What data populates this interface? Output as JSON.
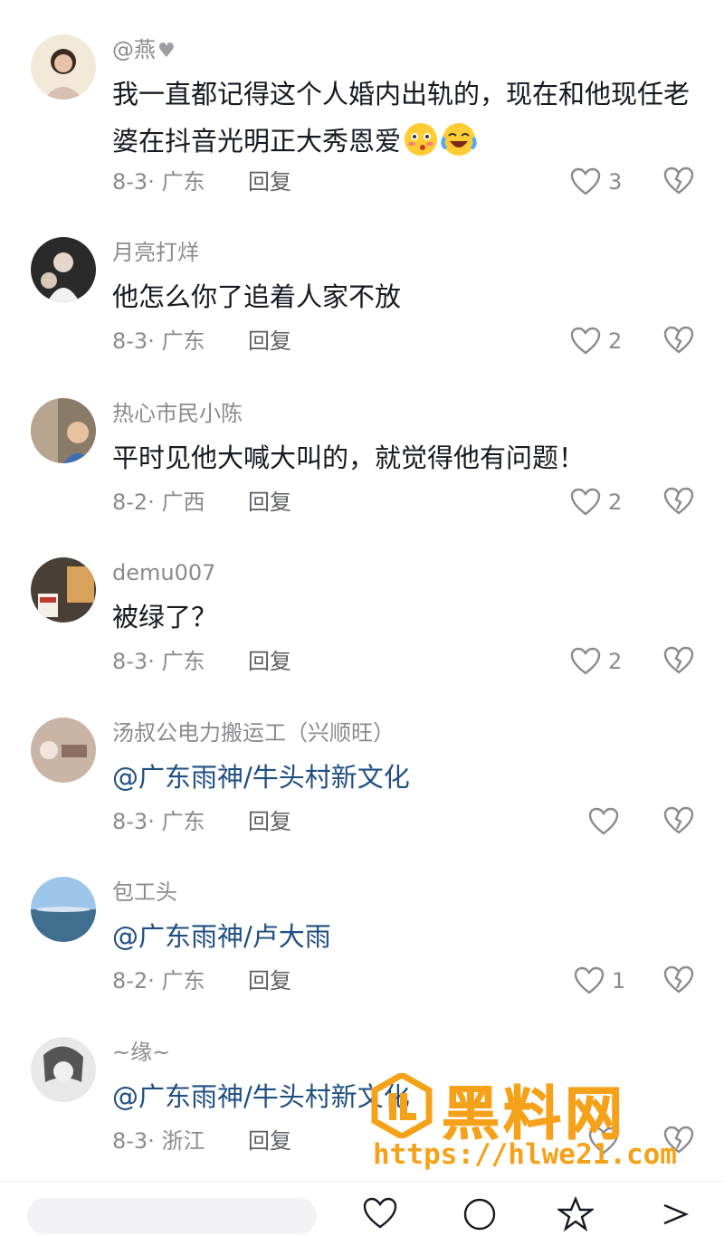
{
  "comments": [
    {
      "username": "@燕",
      "username_heart": "♥",
      "text": "我一直都记得这个人婚内出轨的，现在和他现任老婆在抖音光明正大秀恩爱",
      "emojis": [
        "blushing-emoji",
        "laughing-crying-emoji"
      ],
      "date": "8-3",
      "location": "广东",
      "reply": "回复",
      "likes": "3",
      "mention": false
    },
    {
      "username": "月亮打烊",
      "text": "他怎么你了追着人家不放",
      "date": "8-3",
      "location": "广东",
      "reply": "回复",
      "likes": "2",
      "mention": false
    },
    {
      "username": "热心市民小陈",
      "text": "平时见他大喊大叫的，就觉得他有问题！",
      "date": "8-2",
      "location": "广西",
      "reply": "回复",
      "likes": "2",
      "mention": false
    },
    {
      "username": "demu007",
      "text": "被绿了？",
      "date": "8-3",
      "location": "广东",
      "reply": "回复",
      "likes": "2",
      "mention": false
    },
    {
      "username": "汤叔公电力搬运工（兴顺旺）",
      "text": "@广东雨神/牛头村新文化",
      "date": "8-3",
      "location": "广东",
      "reply": "回复",
      "likes": "",
      "mention": true
    },
    {
      "username": "包工头",
      "text": "@广东雨神/卢大雨",
      "date": "8-2",
      "location": "广东",
      "reply": "回复",
      "likes": "1",
      "mention": true
    },
    {
      "username": "~缘~",
      "text": "@广东雨神/牛头村新文化",
      "date": "8-3",
      "location": "浙江",
      "reply": "回复",
      "likes": "",
      "mention": true
    }
  ],
  "watermark": {
    "title": "黑料网",
    "url": "https://hlwe21.com"
  },
  "colors": {
    "text": "#161823",
    "secondary": "#8a8b91",
    "mention": "#1f4f82",
    "watermark": "#f5a21a"
  }
}
